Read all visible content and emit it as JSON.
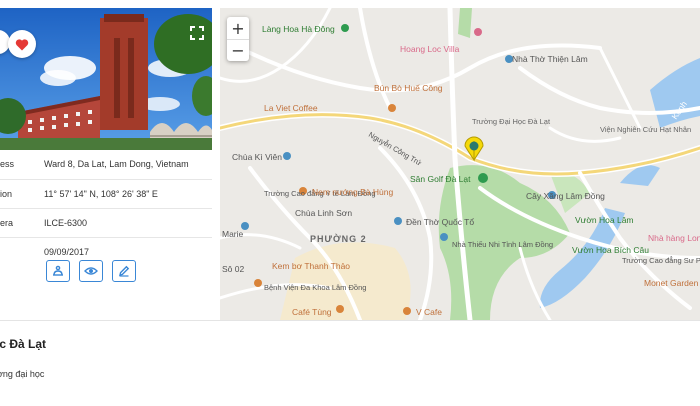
{
  "info": {
    "rows": [
      {
        "key": "ess",
        "value": "Ward 8, Da Lat, Lam Dong, Vietnam"
      },
      {
        "key": "ion",
        "value": "11° 57' 14\" N, 108° 26' 38\" E"
      },
      {
        "key": "era",
        "value": "ILCE-6300"
      },
      {
        "key": "",
        "value": "09/09/2017"
      }
    ],
    "actions": [
      {
        "name": "camera-icon"
      },
      {
        "name": "eye-icon"
      },
      {
        "name": "pencil-icon"
      }
    ]
  },
  "map": {
    "zoom_in": "+",
    "zoom_out": "−",
    "labels": [
      {
        "t": "Làng Hoa Hà Đông",
        "c": "#2e7d32"
      },
      {
        "t": "Hoang Loc Villa",
        "c": "#d96a8a"
      },
      {
        "t": "Nhà Thờ Thiện Lâm",
        "c": "#555"
      },
      {
        "t": "Bún Bò Huế Công",
        "c": "#c0703a"
      },
      {
        "t": "Trường Đại Học Đà Lạt",
        "c": "#666"
      },
      {
        "t": "Viện Nghiên Cứu Hạt Nhân",
        "c": "#666"
      },
      {
        "t": "La Viet Coffee",
        "c": "#c0703a"
      },
      {
        "t": "Nguyễn Công Trứ",
        "c": "#555"
      },
      {
        "t": "Chùa Kì Viên",
        "c": "#555"
      },
      {
        "t": "Sân Golf Đà Lạt",
        "c": "#2e7d32"
      },
      {
        "t": "Cây Xăng Lâm Đồng",
        "c": "#555"
      },
      {
        "t": "Trường Cao đẳng Y tế Lâm Đồng",
        "c": "#555"
      },
      {
        "t": "Nem nướng Bà Hùng",
        "c": "#c0703a"
      },
      {
        "t": "Chùa Linh Sơn",
        "c": "#555"
      },
      {
        "t": "Đền Thờ Quốc Tổ",
        "c": "#555"
      },
      {
        "t": "Vườn Hoa Lâm",
        "c": "#2e7d32"
      },
      {
        "t": "Nhà hàng Long",
        "c": "#d96a8a"
      },
      {
        "t": "PHƯỜNG 2",
        "c": "#666"
      },
      {
        "t": "Nhà Thiếu Nhi Tỉnh Lâm Đồng",
        "c": "#555"
      },
      {
        "t": "Vườn Hoa Bích Câu",
        "c": "#2e7d32"
      },
      {
        "t": "Trường Cao đẳng Sư Phạm Đà Lạt",
        "c": "#555"
      },
      {
        "t": "Kem bơ Thanh Thảo",
        "c": "#c0703a"
      },
      {
        "t": "Bệnh Viện Đa Khoa Lâm Đồng",
        "c": "#555"
      },
      {
        "t": "Monet Garden",
        "c": "#c0703a"
      },
      {
        "t": "Café Tùng",
        "c": "#c0703a"
      },
      {
        "t": "V Cafe",
        "c": "#c0703a"
      },
      {
        "t": "Marie",
        "c": "#555"
      },
      {
        "t": "Sô 02",
        "c": "#555"
      },
      {
        "t": "Kênh",
        "c": "#fff"
      }
    ]
  },
  "place": {
    "title": "ọc Đà Lạt",
    "subtitle": "rờng đại học"
  },
  "colors": {
    "accent": "#3a87d6",
    "heart": "#e53935",
    "water": "#9fc9f0",
    "green_area": "#b5dca8",
    "map_bg": "#eceae6"
  }
}
